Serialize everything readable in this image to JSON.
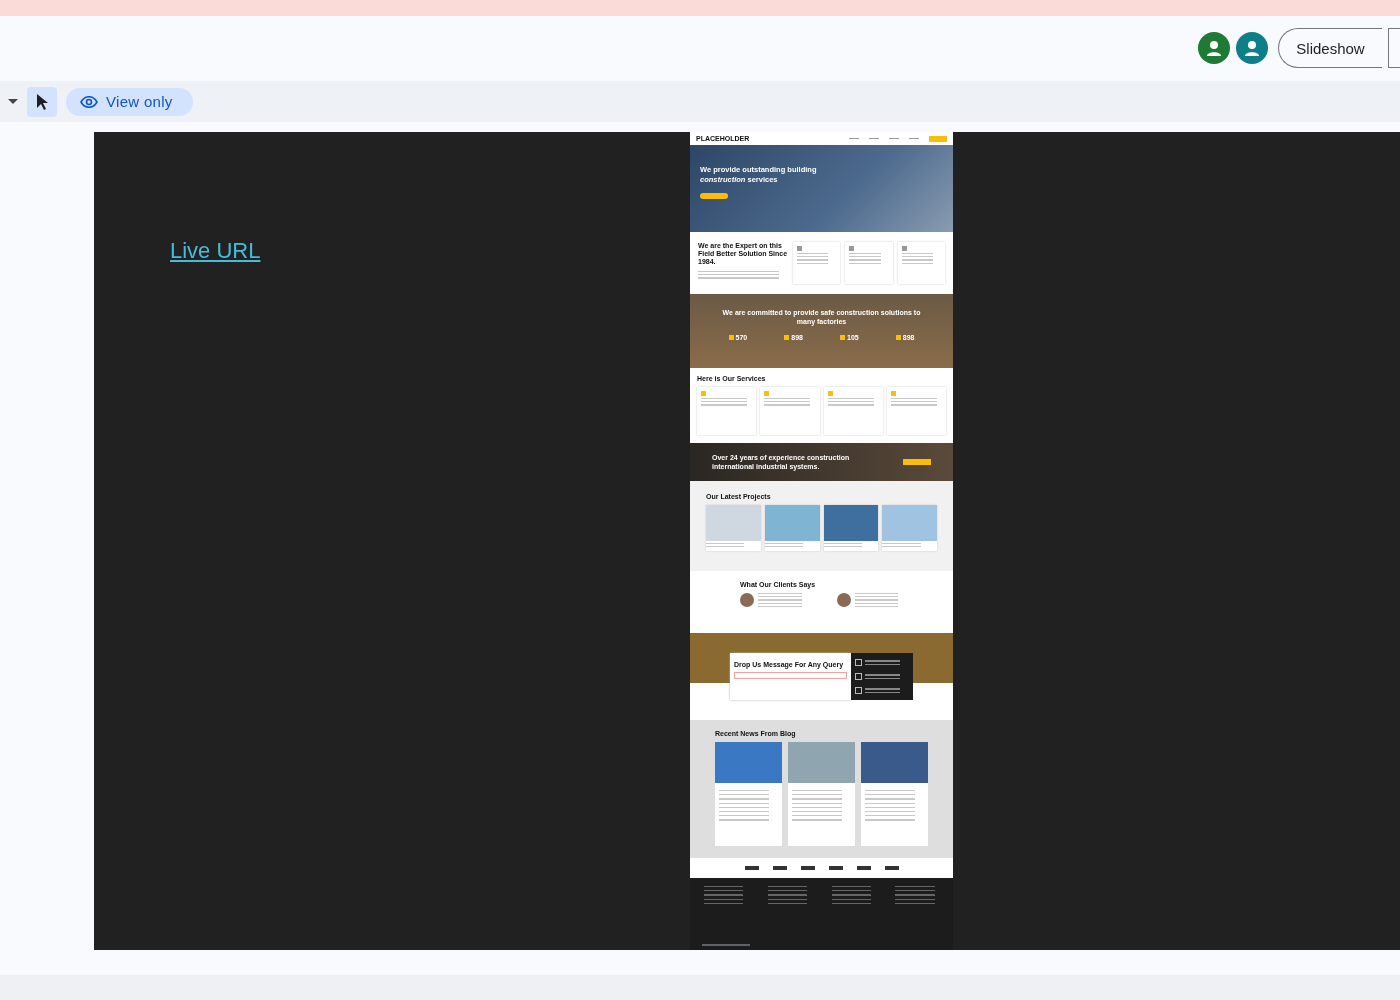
{
  "header": {
    "avatars": [
      {
        "color": "#1e7a34"
      },
      {
        "color": "#0d7f86"
      }
    ],
    "slideshow_button": "Slideshow"
  },
  "toolbar": {
    "tools": [
      {
        "kind": "pointer",
        "selected": true
      }
    ],
    "mode": "View only"
  },
  "slide": {
    "link": "Live URL",
    "website": {
      "brand": "PLACEHOLDER",
      "hero": {
        "title": "We provide outstanding building *construction* services"
      },
      "expert": {
        "title": "We are the Expert on this Field Better Solution Since 1984."
      },
      "committed": {
        "title": "We are committed to provide safe construction solutions to many factories",
        "stats": [
          "570",
          "898",
          "105",
          "898"
        ]
      },
      "services": {
        "title": "Here is Our Services"
      },
      "banner": {
        "title": "Over 24 years of experience construction international industrial systems."
      },
      "projects": {
        "title": "Our Latest Projects",
        "cards": [
          {
            "color": "#cfd8e0"
          },
          {
            "color": "#7fb4d2"
          },
          {
            "color": "#3e6f9e"
          },
          {
            "color": "#9fc3e0"
          }
        ]
      },
      "clients": {
        "title": "What Our Clients Says"
      },
      "contact": {
        "title": "Drop Us Message For Any Query"
      },
      "blog": {
        "title": "Recent News From Blog",
        "cards": [
          {
            "color": "#3b78c4"
          },
          {
            "color": "#8fa6b0"
          },
          {
            "color": "#3a5a8c"
          }
        ]
      }
    }
  }
}
